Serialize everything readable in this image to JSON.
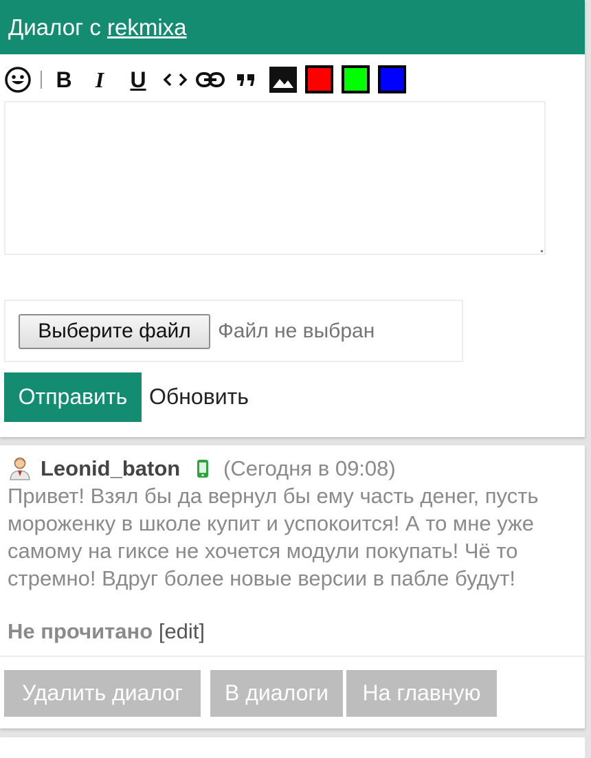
{
  "header": {
    "title_prefix": "Диалог с",
    "username": "rekmixa",
    "bg_color": "#138c72"
  },
  "toolbar": {
    "buttons": [
      {
        "icon": "smiley-icon"
      },
      {
        "icon": "separator"
      },
      {
        "label": "B",
        "icon": "bold-icon"
      },
      {
        "label": "I",
        "icon": "italic-icon"
      },
      {
        "label": "U",
        "icon": "underline-icon"
      },
      {
        "icon": "code-icon"
      },
      {
        "icon": "link-icon"
      },
      {
        "icon": "quote-icon"
      },
      {
        "icon": "image-icon"
      }
    ],
    "colors": [
      "#ff0000",
      "#00ff00",
      "#0000ff"
    ]
  },
  "editor": {
    "value": "",
    "placeholder": ""
  },
  "file": {
    "button_label": "Выберите файл",
    "status": "Файл не выбран"
  },
  "actions": {
    "send_label": "Отправить",
    "refresh_label": "Обновить"
  },
  "message": {
    "author": "Leonid_baton",
    "time": "(Сегодня в 09:08)",
    "text": "Привет! Взял бы да вернул бы ему часть денег, пусть мороженку в школе купит и успокоится! А то мне уже самому на гиксе не хочется модули покупать! Чё то стремно! Вдруг более новые версии в пабле будут!",
    "status": "Не прочитано",
    "edit_label": "[edit]"
  },
  "nav": {
    "delete_label": "Удалить диалог",
    "dialogs_label": "В диалоги",
    "home_label": "На главную"
  }
}
